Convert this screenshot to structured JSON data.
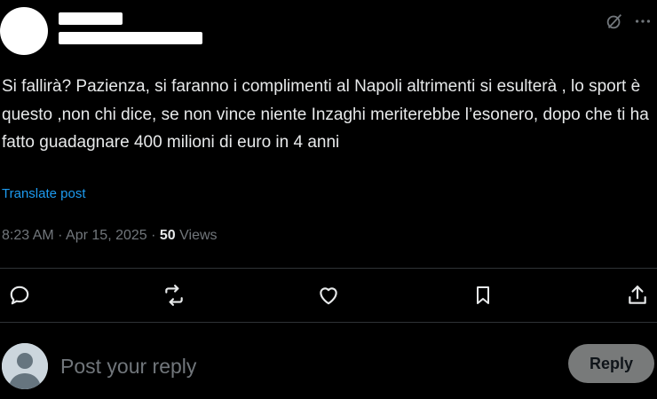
{
  "post": {
    "text": "Si fallirà? Pazienza, si faranno i complimenti al Napoli altrimenti si esulterà , lo sport è questo ,non chi dice, se non vince niente Inzaghi meriterebbe l’esonero, dopo che ti ha fatto guadagnare 400 milioni di euro in 4 anni",
    "translate_label": "Translate post",
    "time": "8:23 AM",
    "sep1": "·",
    "date": "Apr 15, 2025",
    "sep2": "·",
    "views_count": "50",
    "views_label": "Views"
  },
  "icons": {
    "header": [
      "grok-icon",
      "more-icon"
    ],
    "actions": [
      "reply-icon",
      "repost-icon",
      "like-icon",
      "bookmark-icon",
      "share-icon"
    ]
  },
  "reply": {
    "placeholder": "Post your reply",
    "button_label": "Reply"
  },
  "colors": {
    "background": "#000000",
    "text": "#e7e9ea",
    "muted": "#71767b",
    "link": "#1d9bf0",
    "divider": "#2f3336",
    "reply_button_bg": "#787a7a"
  }
}
